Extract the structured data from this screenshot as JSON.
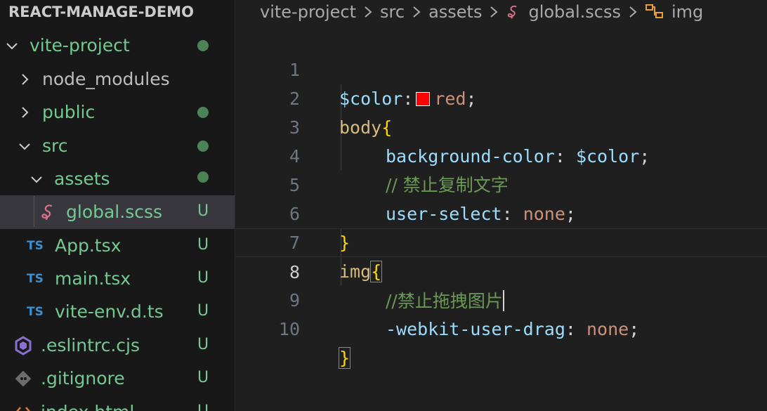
{
  "explorer": {
    "header": "REACT-MANAGE-DEMO",
    "items": [
      {
        "label": "vite-project",
        "status": "dot"
      },
      {
        "label": "node_modules",
        "status": ""
      },
      {
        "label": "public",
        "status": "dot"
      },
      {
        "label": "src",
        "status": "dot"
      },
      {
        "label": "assets",
        "status": "dot"
      },
      {
        "label": "global.scss",
        "status": "U"
      },
      {
        "label": "App.tsx",
        "status": "U",
        "icon_text": "TS"
      },
      {
        "label": "main.tsx",
        "status": "U",
        "icon_text": "TS"
      },
      {
        "label": "vite-env.d.ts",
        "status": "U",
        "icon_text": "TS"
      },
      {
        "label": ".eslintrc.cjs",
        "status": "U"
      },
      {
        "label": ".gitignore",
        "status": "U"
      },
      {
        "label": "index.html",
        "status": "U"
      }
    ]
  },
  "breadcrumb": [
    "vite-project",
    "src",
    "assets",
    "global.scss",
    "img"
  ],
  "editor": {
    "active_line": "8",
    "lines": [
      {
        "num": "1",
        "tokens": [
          "$color",
          ":",
          "red",
          ";"
        ]
      },
      {
        "num": "2",
        "tokens": [
          "body",
          "{"
        ]
      },
      {
        "num": "3",
        "tokens": [
          "background-color",
          ": ",
          "$color",
          ";"
        ]
      },
      {
        "num": "4",
        "tokens": [
          "// 禁止复制文字"
        ]
      },
      {
        "num": "5",
        "tokens": [
          "user-select",
          ": ",
          "none",
          ";"
        ]
      },
      {
        "num": "6",
        "tokens": [
          "}"
        ]
      },
      {
        "num": "7",
        "tokens": [
          "img",
          "{"
        ]
      },
      {
        "num": "8",
        "tokens": [
          "//禁止拖拽图片"
        ]
      },
      {
        "num": "9",
        "tokens": [
          "-webkit-user-drag",
          ": ",
          "none",
          ";"
        ]
      },
      {
        "num": "10",
        "tokens": [
          "}"
        ]
      }
    ]
  },
  "icons": [
    "chevron-down-icon",
    "chevron-right-icon",
    "sass-icon",
    "typescript-icon",
    "eslint-icon",
    "git-icon",
    "html-icon",
    "symbol-class-icon",
    "color-swatch"
  ],
  "colors": {
    "swatch": "#ff0000",
    "status_untracked": "#73c991",
    "ts": "#3b8ed0",
    "sass": "#e0708f"
  }
}
